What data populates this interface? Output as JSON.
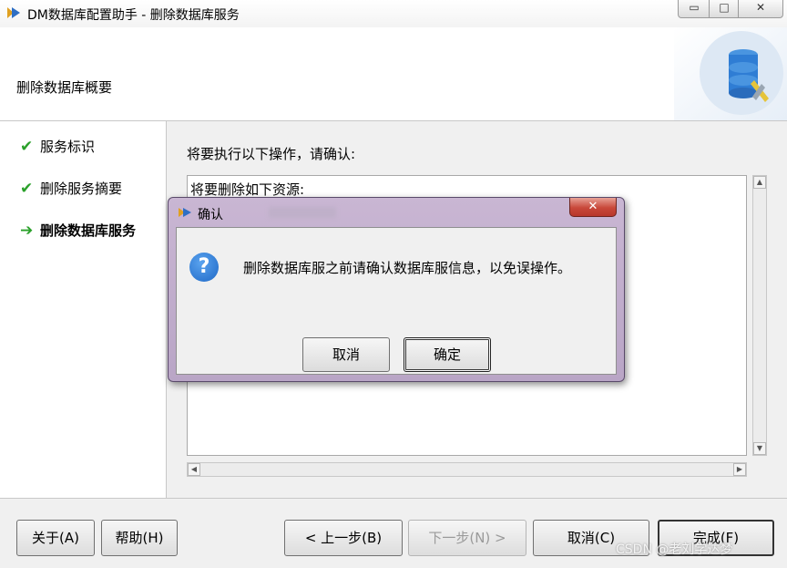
{
  "window": {
    "title": "DM数据库配置助手 - 删除数据库服务",
    "controls": {
      "minimize": "▭",
      "maximize": "□",
      "close": "✕"
    }
  },
  "header": {
    "title": "删除数据库概要",
    "logo_icon": "database-tools-icon"
  },
  "steps": [
    {
      "label": "服务标识",
      "status": "done",
      "icon": "checkmark-icon"
    },
    {
      "label": "删除服务摘要",
      "status": "done",
      "icon": "checkmark-icon"
    },
    {
      "label": "删除数据库服务",
      "status": "current",
      "icon": "arrow-right-icon"
    }
  ],
  "main": {
    "prompt": "将要执行以下操作，请确认:",
    "details_text": "将要删除如下资源:"
  },
  "footer": {
    "about": "关于(A)",
    "help": "帮助(H)",
    "prev": "< 上一步(B)",
    "next": "下一步(N) >",
    "cancel": "取消(C)",
    "finish": "完成(F)"
  },
  "dialog": {
    "title": "确认",
    "message": "删除数据库服之前请确认数据库服信息，以免误操作。",
    "cancel": "取消",
    "ok": "确定",
    "icon": "question-icon",
    "close": "✕"
  },
  "watermark": "CSDN @老刘学达梦",
  "colors": {
    "check": "#2aa02a",
    "dialog_frame": "#c2afcf",
    "close_button": "#c8483a",
    "question": "#1e68c6"
  }
}
